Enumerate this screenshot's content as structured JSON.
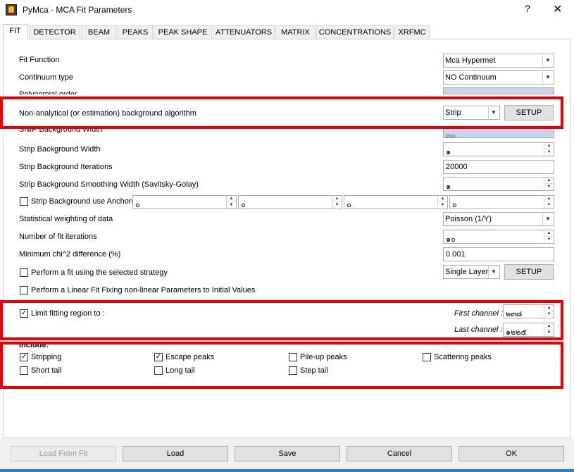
{
  "window": {
    "title": "PyMca - MCA Fit Parameters",
    "help_glyph": "?",
    "close_glyph": "✕"
  },
  "tabs": [
    {
      "label": "FIT"
    },
    {
      "label": "DETECTOR"
    },
    {
      "label": "BEAM"
    },
    {
      "label": "PEAKS"
    },
    {
      "label": "PEAK SHAPE"
    },
    {
      "label": "ATTENUATORS"
    },
    {
      "label": "MATRIX"
    },
    {
      "label": "CONCENTRATIONS"
    },
    {
      "label": "XRFMC"
    }
  ],
  "fit": {
    "fit_function": {
      "label": "Fit Function",
      "value": "Mca Hypermet"
    },
    "continuum": {
      "label": "Continuum type",
      "value": "NO Continuum"
    },
    "polynomial": {
      "label": "Polynomial order",
      "value": "."
    },
    "background": {
      "label": "Non-analytical (or estimation) background algorithm",
      "value": "Strip",
      "button": "SETUP"
    },
    "snip_width": {
      "label": "SNIP Background Width",
      "value": "๓๐"
    },
    "strip_width": {
      "label": "Strip Background Width",
      "value": "๑"
    },
    "strip_iterations": {
      "label": "Strip Background Iterations",
      "value": "20000"
    },
    "strip_smoothing": {
      "label": "Strip Background Smoothing Width (Savitsky-Golay)",
      "value": "๑"
    },
    "anchors": {
      "label": "Strip Background use Anchors",
      "values": [
        "๐",
        "๐",
        "๐",
        "๐"
      ]
    },
    "weighting": {
      "label": "Statistical weighting of data",
      "value": "Poisson (1/Y)"
    },
    "iterations": {
      "label": "Number of fit iterations",
      "value": "๑๐"
    },
    "chi2": {
      "label": "Minimum chi^2 difference (%)",
      "value": "0.001"
    },
    "strategy": {
      "label": "Perform a fit using the selected strategy",
      "value": "Single Layer",
      "button": "SETUP"
    },
    "linear_fit": {
      "label": "Perform a Linear Fit Fixing non-linear Parameters to Initial Values"
    },
    "limit": {
      "label": "Limit fitting region to :",
      "check": "✓",
      "first_label": "First channel :",
      "first_value": "๒๓๘",
      "last_label": "Last channel :",
      "last_value": "๑๒๒๕"
    },
    "include": {
      "label": "Include:",
      "items": [
        {
          "label": "Stripping",
          "check": "✓"
        },
        {
          "label": "Escape peaks",
          "check": "✓"
        },
        {
          "label": "Pile-up peaks",
          "check": ""
        },
        {
          "label": "Scattering peaks",
          "check": ""
        },
        {
          "label": "Short tail",
          "check": ""
        },
        {
          "label": "Long tail",
          "check": ""
        },
        {
          "label": "Step tail",
          "check": ""
        }
      ]
    }
  },
  "buttons": {
    "load_from_fit": "Load From Fit",
    "load": "Load",
    "save": "Save",
    "cancel": "Cancel",
    "ok": "OK"
  },
  "glyphs": {
    "down": "▼",
    "up": "▲",
    "spin_down": "▼"
  },
  "colors": {
    "highlight": "#ee0000",
    "disabled_field": "#c8d4ee",
    "taskbar_line": "#2f7fc4"
  }
}
